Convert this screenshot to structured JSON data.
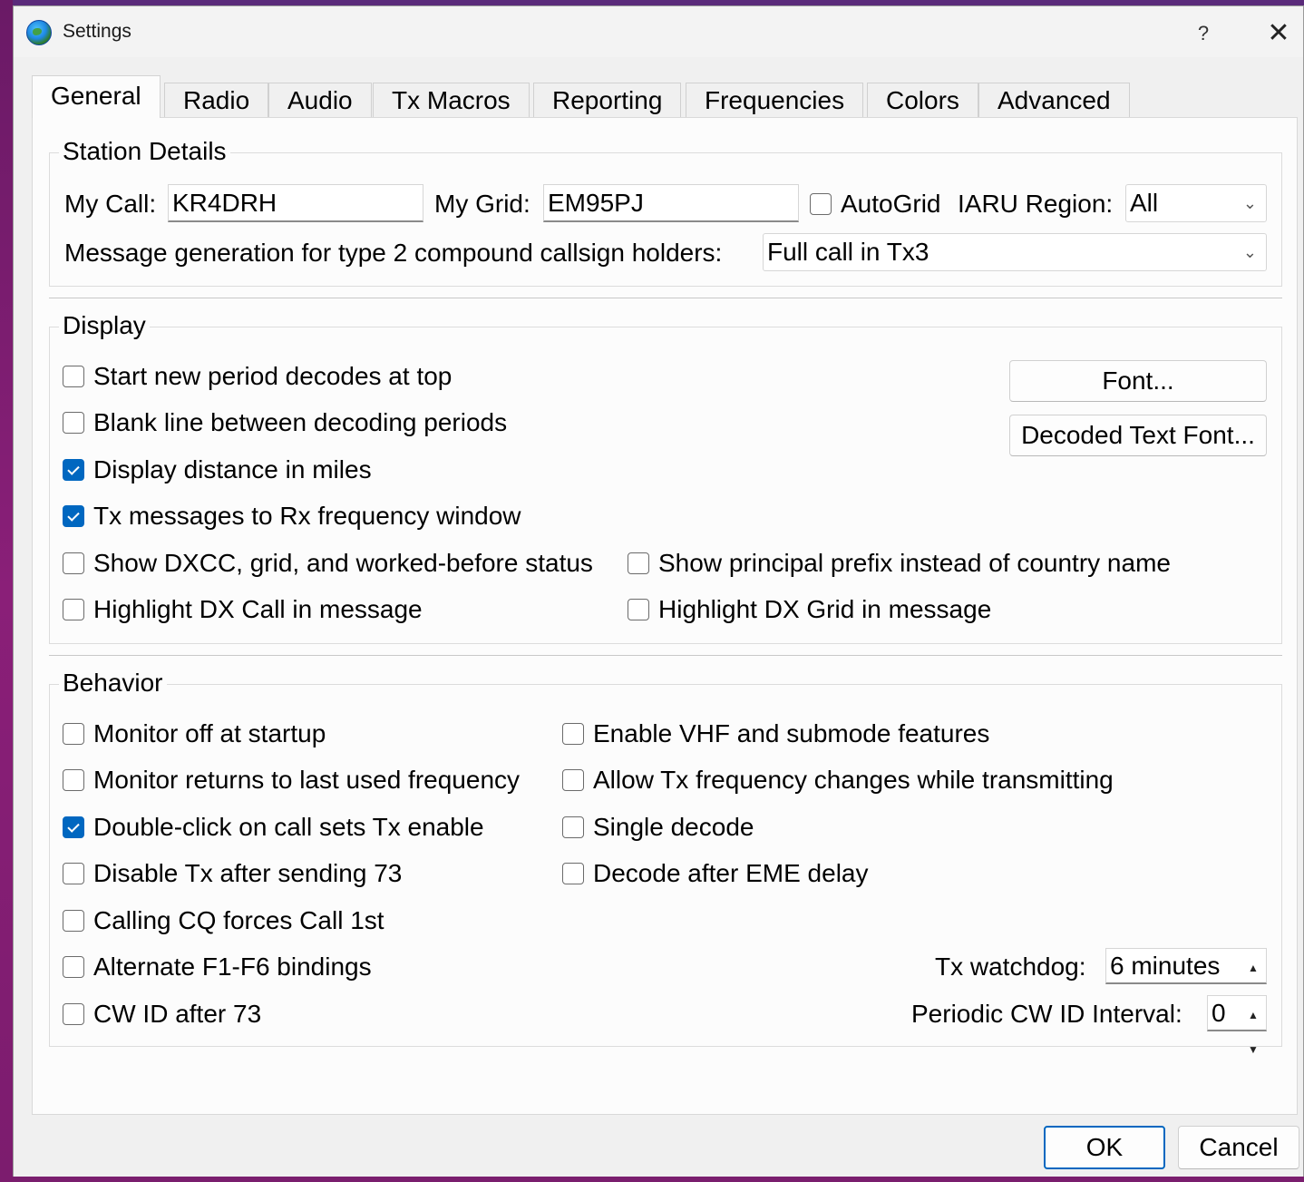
{
  "window": {
    "title": "Settings",
    "help_label": "?",
    "close_label": "✕"
  },
  "tabs": [
    {
      "label": "General",
      "active": true
    },
    {
      "label": "Radio"
    },
    {
      "label": "Audio"
    },
    {
      "label": "Tx Macros"
    },
    {
      "label": "Reporting"
    },
    {
      "label": "Frequencies"
    },
    {
      "label": "Colors"
    },
    {
      "label": "Advanced"
    }
  ],
  "station": {
    "title": "Station Details",
    "my_call_label": "My Call:",
    "my_call_value": "KR4DRH",
    "my_grid_label": "My Grid:",
    "my_grid_value": "EM95PJ",
    "autogrid_label": "AutoGrid",
    "autogrid_checked": false,
    "iaru_label": "IARU Region:",
    "iaru_value": "All",
    "msggen_label": "Message generation for type 2 compound callsign holders:",
    "msggen_value": "Full call in Tx3"
  },
  "display": {
    "title": "Display",
    "items": [
      {
        "label": "Start new period decodes at top",
        "checked": false
      },
      {
        "label": "Blank line between decoding periods",
        "checked": false
      },
      {
        "label": "Display distance in miles",
        "checked": true
      },
      {
        "label": "Tx messages to Rx frequency window",
        "checked": true
      },
      {
        "label": "Show DXCC, grid, and worked-before status",
        "checked": false
      },
      {
        "label": "Highlight DX Call in message",
        "checked": false
      },
      {
        "label": "Show principal prefix instead of country name",
        "checked": false
      },
      {
        "label": "Highlight DX Grid in message",
        "checked": false
      }
    ],
    "font_button": "Font...",
    "decoded_font_button": "Decoded Text Font..."
  },
  "behavior": {
    "title": "Behavior",
    "left_items": [
      {
        "label": "Monitor off at startup",
        "checked": false
      },
      {
        "label": "Monitor returns to last used frequency",
        "checked": false
      },
      {
        "label": "Double-click on call sets Tx enable",
        "checked": true
      },
      {
        "label": "Disable Tx after sending 73",
        "checked": false
      },
      {
        "label": "Calling CQ forces Call 1st",
        "checked": false
      },
      {
        "label": "Alternate F1-F6 bindings",
        "checked": false
      },
      {
        "label": "CW ID after 73",
        "checked": false
      }
    ],
    "right_items": [
      {
        "label": "Enable VHF and submode features",
        "checked": false
      },
      {
        "label": "Allow Tx frequency changes while transmitting",
        "checked": false
      },
      {
        "label": "Single decode",
        "checked": false
      },
      {
        "label": "Decode after EME delay",
        "checked": false
      }
    ],
    "watchdog_label": "Tx watchdog:",
    "watchdog_value": "6 minutes",
    "cwid_label": "Periodic CW ID Interval:",
    "cwid_value": "0"
  },
  "footer": {
    "ok_label": "OK",
    "cancel_label": "Cancel"
  },
  "colors": {
    "accent": "#0067c0"
  }
}
